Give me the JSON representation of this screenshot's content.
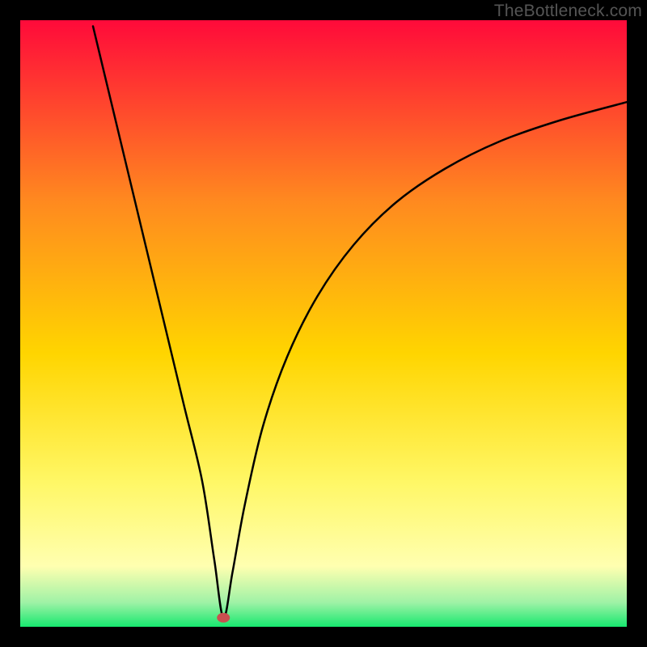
{
  "watermark": "TheBottleneck.com",
  "chart_data": {
    "type": "line",
    "title": "",
    "xlabel": "",
    "ylabel": "",
    "xlim": [
      0,
      100
    ],
    "ylim": [
      0,
      100
    ],
    "grid": false,
    "series": [
      {
        "name": "left-branch",
        "x": [
          12.0,
          15.0,
          18.0,
          21.0,
          24.0,
          27.0,
          30.0,
          32.0,
          33.5
        ],
        "values": [
          99.0,
          86.5,
          74.0,
          61.5,
          49.0,
          36.5,
          24.0,
          11.0,
          1.5
        ]
      },
      {
        "name": "right-branch",
        "x": [
          33.5,
          35.0,
          37.0,
          40.0,
          44.0,
          49.0,
          55.0,
          62.0,
          70.0,
          79.0,
          89.0,
          100.0
        ],
        "values": [
          1.5,
          9.0,
          20.0,
          33.0,
          44.5,
          54.5,
          63.0,
          70.0,
          75.5,
          80.0,
          83.5,
          86.5
        ]
      }
    ],
    "marker": {
      "name": "minimum-point",
      "x": 33.5,
      "y": 1.5,
      "color": "#c94f4f"
    },
    "background_gradient": {
      "top": "#ff0a3a",
      "mid_upper": "#ff8a1f",
      "mid": "#ffd500",
      "mid_lower": "#fff765",
      "pale": "#ffffb0",
      "green_light": "#9ff2a6",
      "green": "#17e86f"
    }
  }
}
